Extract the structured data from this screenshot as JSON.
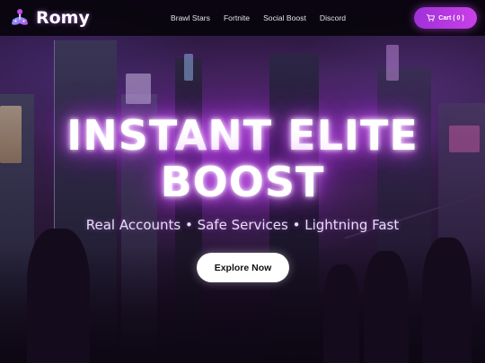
{
  "brand": {
    "name": "Romy",
    "logo_icon": "joystick-logo-icon"
  },
  "nav": {
    "items": [
      {
        "label": "Brawl Stars"
      },
      {
        "label": "Fortnite"
      },
      {
        "label": "Social Boost"
      },
      {
        "label": "Discord"
      }
    ]
  },
  "cart": {
    "label": "Cart",
    "count": "0",
    "icon": "shopping-cart-icon",
    "text": "Cart ( 0 )"
  },
  "hero": {
    "title_line1": "INSTANT ELITE",
    "title_line2": "BOOST",
    "subtitle": "Real Accounts • Safe Services • Lightning Fast",
    "cta_label": "Explore Now"
  },
  "colors": {
    "accent": "#b73ae0",
    "header_bg": "#08040c",
    "cta_bg": "#ffffff",
    "glow": "#c040f0"
  }
}
